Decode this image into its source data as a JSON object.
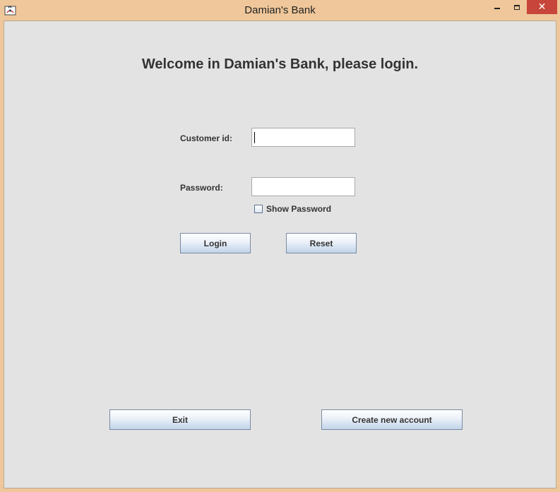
{
  "window": {
    "title": "Damian's Bank",
    "close_glyph": "✕"
  },
  "login": {
    "heading": "Welcome in Damian's Bank, please login.",
    "customer_id_label": "Customer id:",
    "customer_id_value": "",
    "password_label": "Password:",
    "password_value": "",
    "show_password_label": "Show Password",
    "show_password_checked": false,
    "login_button": "Login",
    "reset_button": "Reset"
  },
  "footer": {
    "exit_button": "Exit",
    "create_account_button": "Create new account"
  },
  "colors": {
    "frame": "#efc79a",
    "panel": "#e3e3e3",
    "close_button": "#c7453a"
  }
}
